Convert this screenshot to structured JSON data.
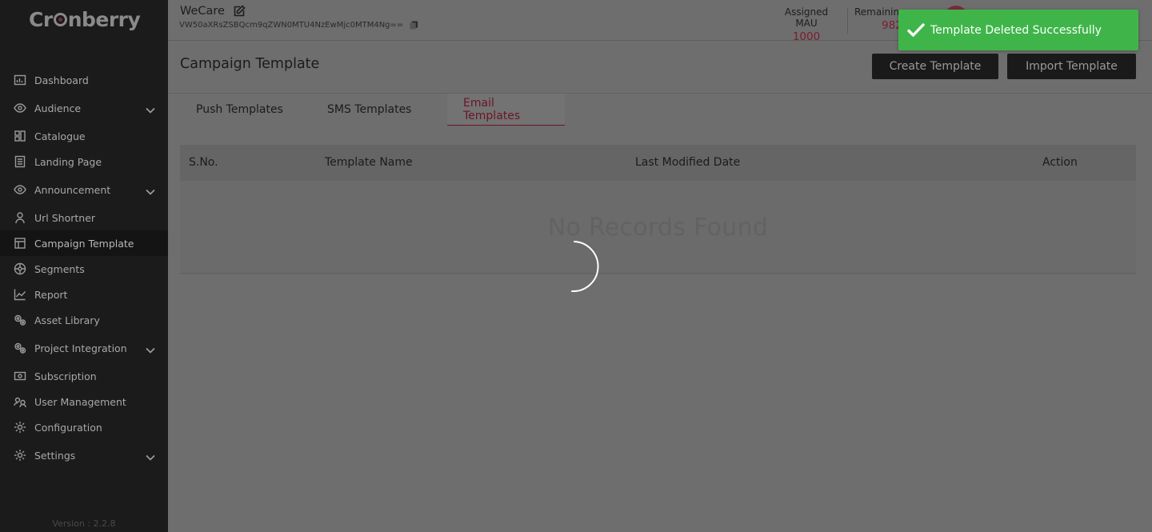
{
  "brand": {
    "logo_left": "Cr",
    "logo_right": "nberry",
    "version": "Version : 2.2.8"
  },
  "sidebar": {
    "items": [
      {
        "label": "Dashboard",
        "icon": "dashboard-icon"
      },
      {
        "label": "Audience",
        "icon": "eye-icon",
        "expandable": true
      },
      {
        "label": "Catalogue",
        "icon": "catalogue-icon"
      },
      {
        "label": "Landing Page",
        "icon": "landing-page-icon"
      },
      {
        "label": "Announcement",
        "icon": "eye-icon",
        "expandable": true
      },
      {
        "label": "Url Shortner",
        "icon": "person-icon"
      },
      {
        "label": "Campaign Template",
        "icon": "template-icon",
        "active": true
      },
      {
        "label": "Segments",
        "icon": "segments-icon"
      },
      {
        "label": "Report",
        "icon": "report-icon"
      },
      {
        "label": "Asset Library",
        "icon": "gears-icon"
      },
      {
        "label": "Project Integration",
        "icon": "gears-icon",
        "expandable": true
      },
      {
        "label": "Subscription",
        "icon": "subscription-icon"
      },
      {
        "label": "User Management",
        "icon": "users-icon"
      },
      {
        "label": "Configuration",
        "icon": "gear-icon"
      },
      {
        "label": "Settings",
        "icon": "gear-icon",
        "expandable": true
      }
    ]
  },
  "header": {
    "app_name": "WeCare",
    "app_key": "VW50aXRsZSBQcm9qZWN0MTU4NzEwMjc0MTM4Ng==",
    "assigned_mau_label": "Assigned MAU",
    "assigned_mau_value": "1000",
    "remaining_label": "Remainin",
    "remaining_value": "982"
  },
  "page": {
    "title": "Campaign Template",
    "create_button": "Create Template",
    "import_button": "Import Template",
    "tabs": [
      "Push Templates",
      "SMS Templates",
      "Email Templates"
    ],
    "active_tab": "Email Templates"
  },
  "table": {
    "columns": [
      "S.No.",
      "Template Name",
      "Last Modified Date",
      "Action"
    ],
    "empty_text": "No Records Found"
  },
  "toast": {
    "message": "Template Deleted Successfully",
    "color": "#3fb549"
  },
  "colors": {
    "accent": "#6a1526",
    "sidebar_bg": "#1b1b1b",
    "overlay": "#6e6e6e"
  }
}
